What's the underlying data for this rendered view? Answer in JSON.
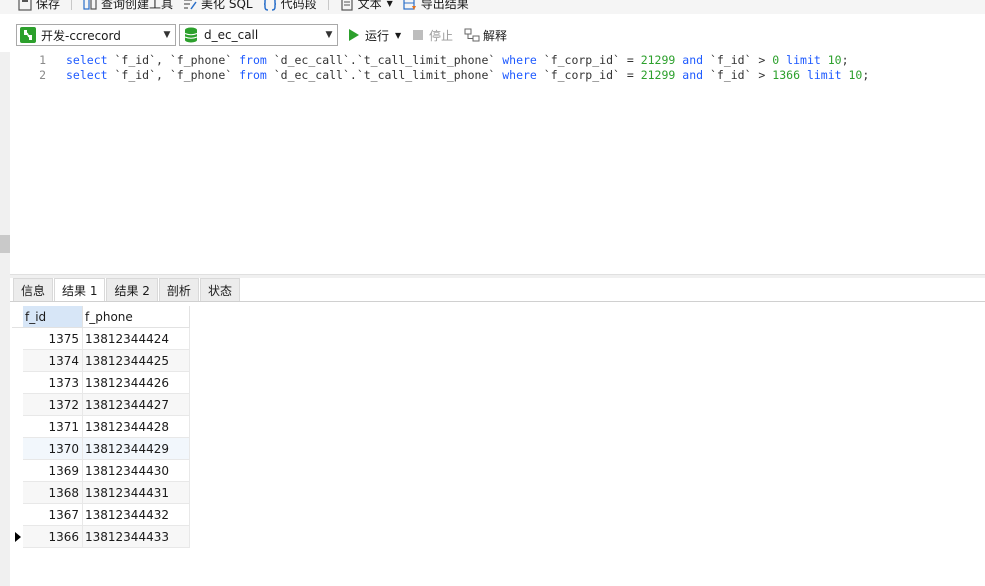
{
  "toolbar": {
    "save_label": "保存",
    "query_builder_label": "查询创建工具",
    "beautify_label": "美化 SQL",
    "snippet_label": "代码段",
    "text_label": "文本",
    "export_label": "导出结果"
  },
  "connection": {
    "name": "开发-ccrecord"
  },
  "database": {
    "name": "d_ec_call"
  },
  "actions": {
    "run_label": "运行",
    "stop_label": "停止",
    "explain_label": "解释"
  },
  "editor": {
    "lines": [
      {
        "number": "1",
        "tokens": [
          {
            "t": "select",
            "c": "kw"
          },
          {
            "t": " `f_id`, `f_phone` ",
            "c": "id"
          },
          {
            "t": "from",
            "c": "kw"
          },
          {
            "t": " `d_ec_call`.`t_call_limit_phone` ",
            "c": "id"
          },
          {
            "t": "where",
            "c": "kw"
          },
          {
            "t": " `f_corp_id` = ",
            "c": "id"
          },
          {
            "t": "21299",
            "c": "num"
          },
          {
            "t": " ",
            "c": "id"
          },
          {
            "t": "and",
            "c": "kw"
          },
          {
            "t": " `f_id` > ",
            "c": "id"
          },
          {
            "t": "0",
            "c": "num"
          },
          {
            "t": " ",
            "c": "id"
          },
          {
            "t": "limit",
            "c": "kw"
          },
          {
            "t": " ",
            "c": "id"
          },
          {
            "t": "10",
            "c": "num"
          },
          {
            "t": ";",
            "c": "id"
          }
        ]
      },
      {
        "number": "2",
        "tokens": [
          {
            "t": "select",
            "c": "kw"
          },
          {
            "t": " `f_id`, `f_phone` ",
            "c": "id"
          },
          {
            "t": "from",
            "c": "kw"
          },
          {
            "t": " `d_ec_call`.`t_call_limit_phone` ",
            "c": "id"
          },
          {
            "t": "where",
            "c": "kw"
          },
          {
            "t": " `f_corp_id` = ",
            "c": "id"
          },
          {
            "t": "21299",
            "c": "num"
          },
          {
            "t": " ",
            "c": "id"
          },
          {
            "t": "and",
            "c": "kw"
          },
          {
            "t": " `f_id` > ",
            "c": "id"
          },
          {
            "t": "1366",
            "c": "num"
          },
          {
            "t": " ",
            "c": "id"
          },
          {
            "t": "limit",
            "c": "kw"
          },
          {
            "t": " ",
            "c": "id"
          },
          {
            "t": "10",
            "c": "num"
          },
          {
            "t": ";",
            "c": "id"
          }
        ]
      }
    ]
  },
  "tabs": [
    {
      "label": "信息",
      "active": false
    },
    {
      "label": "结果 1",
      "active": true
    },
    {
      "label": "结果 2",
      "active": false
    },
    {
      "label": "剖析",
      "active": false
    },
    {
      "label": "状态",
      "active": false
    }
  ],
  "grid": {
    "columns": [
      "f_id",
      "f_phone"
    ],
    "rows": [
      {
        "f_id": "1375",
        "f_phone": "13812344424"
      },
      {
        "f_id": "1374",
        "f_phone": "13812344425"
      },
      {
        "f_id": "1373",
        "f_phone": "13812344426"
      },
      {
        "f_id": "1372",
        "f_phone": "13812344427"
      },
      {
        "f_id": "1371",
        "f_phone": "13812344428"
      },
      {
        "f_id": "1370",
        "f_phone": "13812344429"
      },
      {
        "f_id": "1369",
        "f_phone": "13812344430"
      },
      {
        "f_id": "1368",
        "f_phone": "13812344431"
      },
      {
        "f_id": "1367",
        "f_phone": "13812344432"
      },
      {
        "f_id": "1366",
        "f_phone": "13812344433"
      }
    ],
    "current_row": 9
  },
  "colors": {
    "keyword": "#1e5aff",
    "number": "#2ca02c",
    "run_icon": "#2ca02c",
    "selected_header": "#d7e6f7"
  }
}
